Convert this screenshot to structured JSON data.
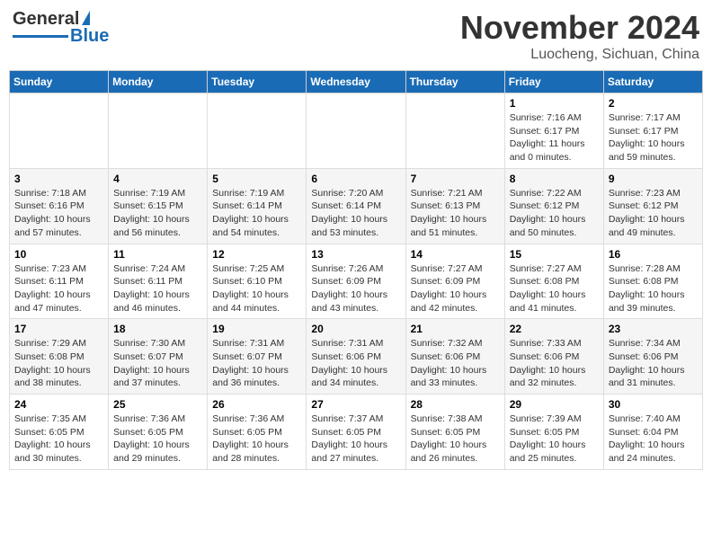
{
  "header": {
    "logo_general": "General",
    "logo_blue": "Blue",
    "month_year": "November 2024",
    "location": "Luocheng, Sichuan, China"
  },
  "weekdays": [
    "Sunday",
    "Monday",
    "Tuesday",
    "Wednesday",
    "Thursday",
    "Friday",
    "Saturday"
  ],
  "weeks": [
    [
      {
        "day": "",
        "info": ""
      },
      {
        "day": "",
        "info": ""
      },
      {
        "day": "",
        "info": ""
      },
      {
        "day": "",
        "info": ""
      },
      {
        "day": "",
        "info": ""
      },
      {
        "day": "1",
        "info": "Sunrise: 7:16 AM\nSunset: 6:17 PM\nDaylight: 11 hours\nand 0 minutes."
      },
      {
        "day": "2",
        "info": "Sunrise: 7:17 AM\nSunset: 6:17 PM\nDaylight: 10 hours\nand 59 minutes."
      }
    ],
    [
      {
        "day": "3",
        "info": "Sunrise: 7:18 AM\nSunset: 6:16 PM\nDaylight: 10 hours\nand 57 minutes."
      },
      {
        "day": "4",
        "info": "Sunrise: 7:19 AM\nSunset: 6:15 PM\nDaylight: 10 hours\nand 56 minutes."
      },
      {
        "day": "5",
        "info": "Sunrise: 7:19 AM\nSunset: 6:14 PM\nDaylight: 10 hours\nand 54 minutes."
      },
      {
        "day": "6",
        "info": "Sunrise: 7:20 AM\nSunset: 6:14 PM\nDaylight: 10 hours\nand 53 minutes."
      },
      {
        "day": "7",
        "info": "Sunrise: 7:21 AM\nSunset: 6:13 PM\nDaylight: 10 hours\nand 51 minutes."
      },
      {
        "day": "8",
        "info": "Sunrise: 7:22 AM\nSunset: 6:12 PM\nDaylight: 10 hours\nand 50 minutes."
      },
      {
        "day": "9",
        "info": "Sunrise: 7:23 AM\nSunset: 6:12 PM\nDaylight: 10 hours\nand 49 minutes."
      }
    ],
    [
      {
        "day": "10",
        "info": "Sunrise: 7:23 AM\nSunset: 6:11 PM\nDaylight: 10 hours\nand 47 minutes."
      },
      {
        "day": "11",
        "info": "Sunrise: 7:24 AM\nSunset: 6:11 PM\nDaylight: 10 hours\nand 46 minutes."
      },
      {
        "day": "12",
        "info": "Sunrise: 7:25 AM\nSunset: 6:10 PM\nDaylight: 10 hours\nand 44 minutes."
      },
      {
        "day": "13",
        "info": "Sunrise: 7:26 AM\nSunset: 6:09 PM\nDaylight: 10 hours\nand 43 minutes."
      },
      {
        "day": "14",
        "info": "Sunrise: 7:27 AM\nSunset: 6:09 PM\nDaylight: 10 hours\nand 42 minutes."
      },
      {
        "day": "15",
        "info": "Sunrise: 7:27 AM\nSunset: 6:08 PM\nDaylight: 10 hours\nand 41 minutes."
      },
      {
        "day": "16",
        "info": "Sunrise: 7:28 AM\nSunset: 6:08 PM\nDaylight: 10 hours\nand 39 minutes."
      }
    ],
    [
      {
        "day": "17",
        "info": "Sunrise: 7:29 AM\nSunset: 6:08 PM\nDaylight: 10 hours\nand 38 minutes."
      },
      {
        "day": "18",
        "info": "Sunrise: 7:30 AM\nSunset: 6:07 PM\nDaylight: 10 hours\nand 37 minutes."
      },
      {
        "day": "19",
        "info": "Sunrise: 7:31 AM\nSunset: 6:07 PM\nDaylight: 10 hours\nand 36 minutes."
      },
      {
        "day": "20",
        "info": "Sunrise: 7:31 AM\nSunset: 6:06 PM\nDaylight: 10 hours\nand 34 minutes."
      },
      {
        "day": "21",
        "info": "Sunrise: 7:32 AM\nSunset: 6:06 PM\nDaylight: 10 hours\nand 33 minutes."
      },
      {
        "day": "22",
        "info": "Sunrise: 7:33 AM\nSunset: 6:06 PM\nDaylight: 10 hours\nand 32 minutes."
      },
      {
        "day": "23",
        "info": "Sunrise: 7:34 AM\nSunset: 6:06 PM\nDaylight: 10 hours\nand 31 minutes."
      }
    ],
    [
      {
        "day": "24",
        "info": "Sunrise: 7:35 AM\nSunset: 6:05 PM\nDaylight: 10 hours\nand 30 minutes."
      },
      {
        "day": "25",
        "info": "Sunrise: 7:36 AM\nSunset: 6:05 PM\nDaylight: 10 hours\nand 29 minutes."
      },
      {
        "day": "26",
        "info": "Sunrise: 7:36 AM\nSunset: 6:05 PM\nDaylight: 10 hours\nand 28 minutes."
      },
      {
        "day": "27",
        "info": "Sunrise: 7:37 AM\nSunset: 6:05 PM\nDaylight: 10 hours\nand 27 minutes."
      },
      {
        "day": "28",
        "info": "Sunrise: 7:38 AM\nSunset: 6:05 PM\nDaylight: 10 hours\nand 26 minutes."
      },
      {
        "day": "29",
        "info": "Sunrise: 7:39 AM\nSunset: 6:05 PM\nDaylight: 10 hours\nand 25 minutes."
      },
      {
        "day": "30",
        "info": "Sunrise: 7:40 AM\nSunset: 6:04 PM\nDaylight: 10 hours\nand 24 minutes."
      }
    ]
  ]
}
